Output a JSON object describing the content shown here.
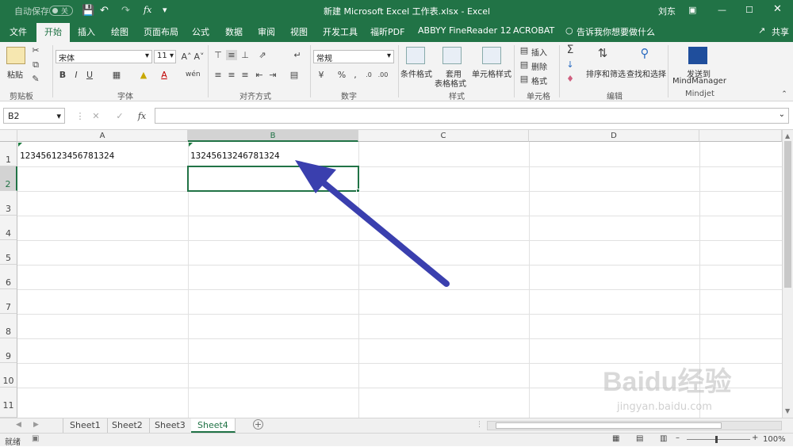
{
  "titlebar": {
    "autosave_label": "自动保存",
    "autosave_state": "关",
    "title": "新建 Microsoft Excel 工作表.xlsx - Excel",
    "user": "刘东"
  },
  "tabs": [
    "文件",
    "开始",
    "插入",
    "绘图",
    "页面布局",
    "公式",
    "数据",
    "审阅",
    "视图",
    "开发工具",
    "福昕PDF",
    "ABBYY FineReader 12",
    "ACROBAT"
  ],
  "active_tab": "开始",
  "tell_me": "告诉我你想要做什么",
  "share": "共享",
  "ribbon": {
    "clipboard": {
      "paste": "粘贴",
      "label": "剪贴板"
    },
    "font": {
      "name": "宋体",
      "size": "11",
      "label": "字体",
      "bold": "B",
      "italic": "I",
      "underline": "U"
    },
    "alignment": {
      "label": "对齐方式"
    },
    "number": {
      "format": "常规",
      "label": "数字"
    },
    "styles": {
      "conditional": "条件格式",
      "table_line1": "套用",
      "table_line2": "表格格式",
      "cell_styles": "单元格样式",
      "label": "样式"
    },
    "cells": {
      "insert": "插入",
      "delete": "删除",
      "format": "格式",
      "label": "单元格"
    },
    "editing": {
      "sort": "排序和筛选",
      "find": "查找和选择",
      "label": "编辑"
    },
    "mindjet": {
      "send_line1": "发送到",
      "send_line2": "MindManager",
      "label": "Mindjet"
    }
  },
  "formula_bar": {
    "name_box": "B2",
    "formula": ""
  },
  "columns": [
    "A",
    "B",
    "C",
    "D"
  ],
  "rows": [
    "1",
    "2",
    "3",
    "4",
    "5",
    "6",
    "7",
    "8",
    "9",
    "10",
    "11"
  ],
  "cells": {
    "A1": "123456123456781324",
    "B1": "13245613246781324"
  },
  "sheets": [
    "Sheet1",
    "Sheet2",
    "Sheet3",
    "Sheet4"
  ],
  "active_sheet": "Sheet4",
  "status": {
    "ready": "就绪",
    "zoom": "100%"
  },
  "watermark": {
    "logo": "Baidu经验",
    "url": "jingyan.baidu.com"
  },
  "colors": {
    "excel_green": "#217346",
    "arrow": "#3a3fae"
  }
}
